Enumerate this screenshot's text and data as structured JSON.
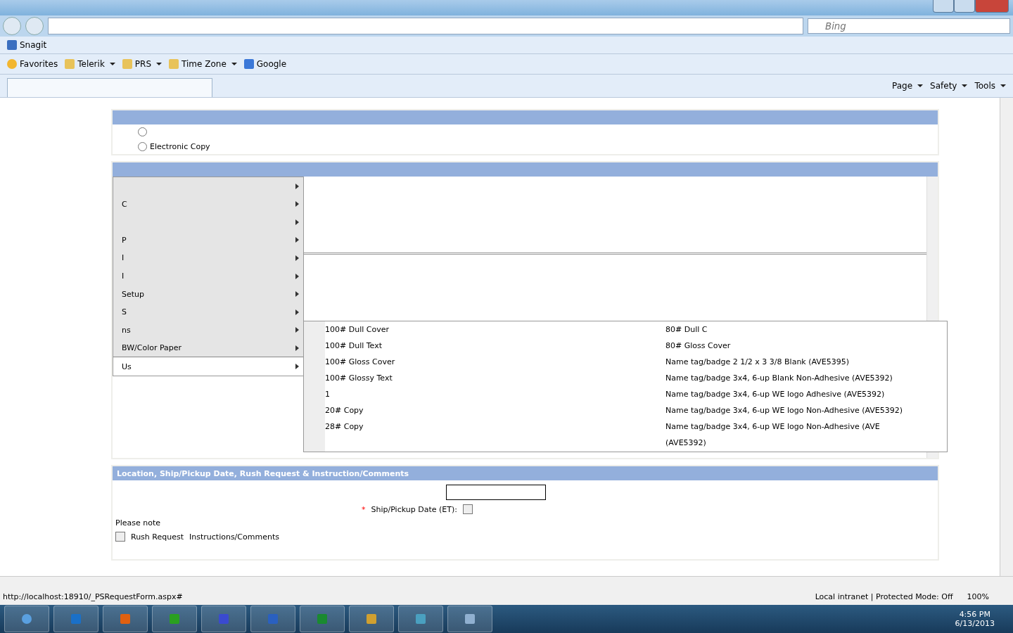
{
  "toolbar": {
    "items": [
      "Snagit"
    ]
  },
  "favorites_bar": {
    "favorites": "Favorites",
    "items": [
      {
        "label": "Telerik",
        "kind": "folder"
      },
      {
        "label": "PRS",
        "kind": "folder"
      },
      {
        "label": "Time Zone",
        "kind": "folder"
      },
      {
        "label": "Google",
        "kind": "link"
      }
    ]
  },
  "search": {
    "placeholder": "Bing"
  },
  "command_bar": [
    "Page",
    "Safety",
    "Tools"
  ],
  "delivery": {
    "options": [
      {
        "selected": false
      },
      {
        "label": "Electronic Copy",
        "selected": false
      }
    ]
  },
  "paper_menu": {
    "items": [
      {
        "selected": false
      },
      {
        "label": "C",
        "selected": false
      },
      {
        "selected": false
      },
      {
        "label": "P",
        "selected": false
      },
      {
        "label": "I",
        "selected": false
      },
      {
        "label": "I",
        "selected": false
      },
      {
        "label": "Setup",
        "selected": false
      },
      {
        "label": "S",
        "selected": false
      },
      {
        "label": "ns",
        "selected": false
      },
      {
        "label": "BW/Color Paper",
        "selected": false
      },
      {
        "label": "Us",
        "selected": true
      }
    ]
  },
  "paper_submenu": {
    "column_1": [
      "100# Dull Cover",
      "100# Dull Text",
      "100# Gloss Cover",
      "100# Glossy Text",
      "1",
      "20# Copy",
      "28# Copy"
    ],
    "column_2": [
      "80# Dull C",
      "80# Gloss Cover",
      "Name tag/badge 2 1/2 x 3 3/8 Blank (AVE5395)",
      "Name tag/badge 3x4, 6-up Blank Non-Adhesive (AVE5392)",
      "Name tag/badge 3x4, 6-up WE logo Adhesive (AVE5392)",
      "Name tag/badge 3x4, 6-up WE logo Non-Adhesive (AVE5392)",
      "Name tag/badge 3x4, 6-up WE logo Non-Adhesive (AVE",
      "(AVE5392)"
    ]
  },
  "location_section": {
    "title": "Location, Ship/Pickup Date, Rush Request & Instruction/Comments",
    "required_mark": "*",
    "date_label": "Ship/Pickup Date (ET):",
    "date_checked": false,
    "rush_checked": false,
    "note": "Please note",
    "rush": "Rush Request",
    "comments": "Instructions/Comments"
  },
  "status_bar": {
    "url": "http://localhost:18910/_PSRequestForm.aspx#",
    "zone": "Local intranet | Protected Mode: Off",
    "zoom": "100%"
  },
  "taskbar": {
    "time": "4:56 PM",
    "date": "6/13/2013"
  }
}
